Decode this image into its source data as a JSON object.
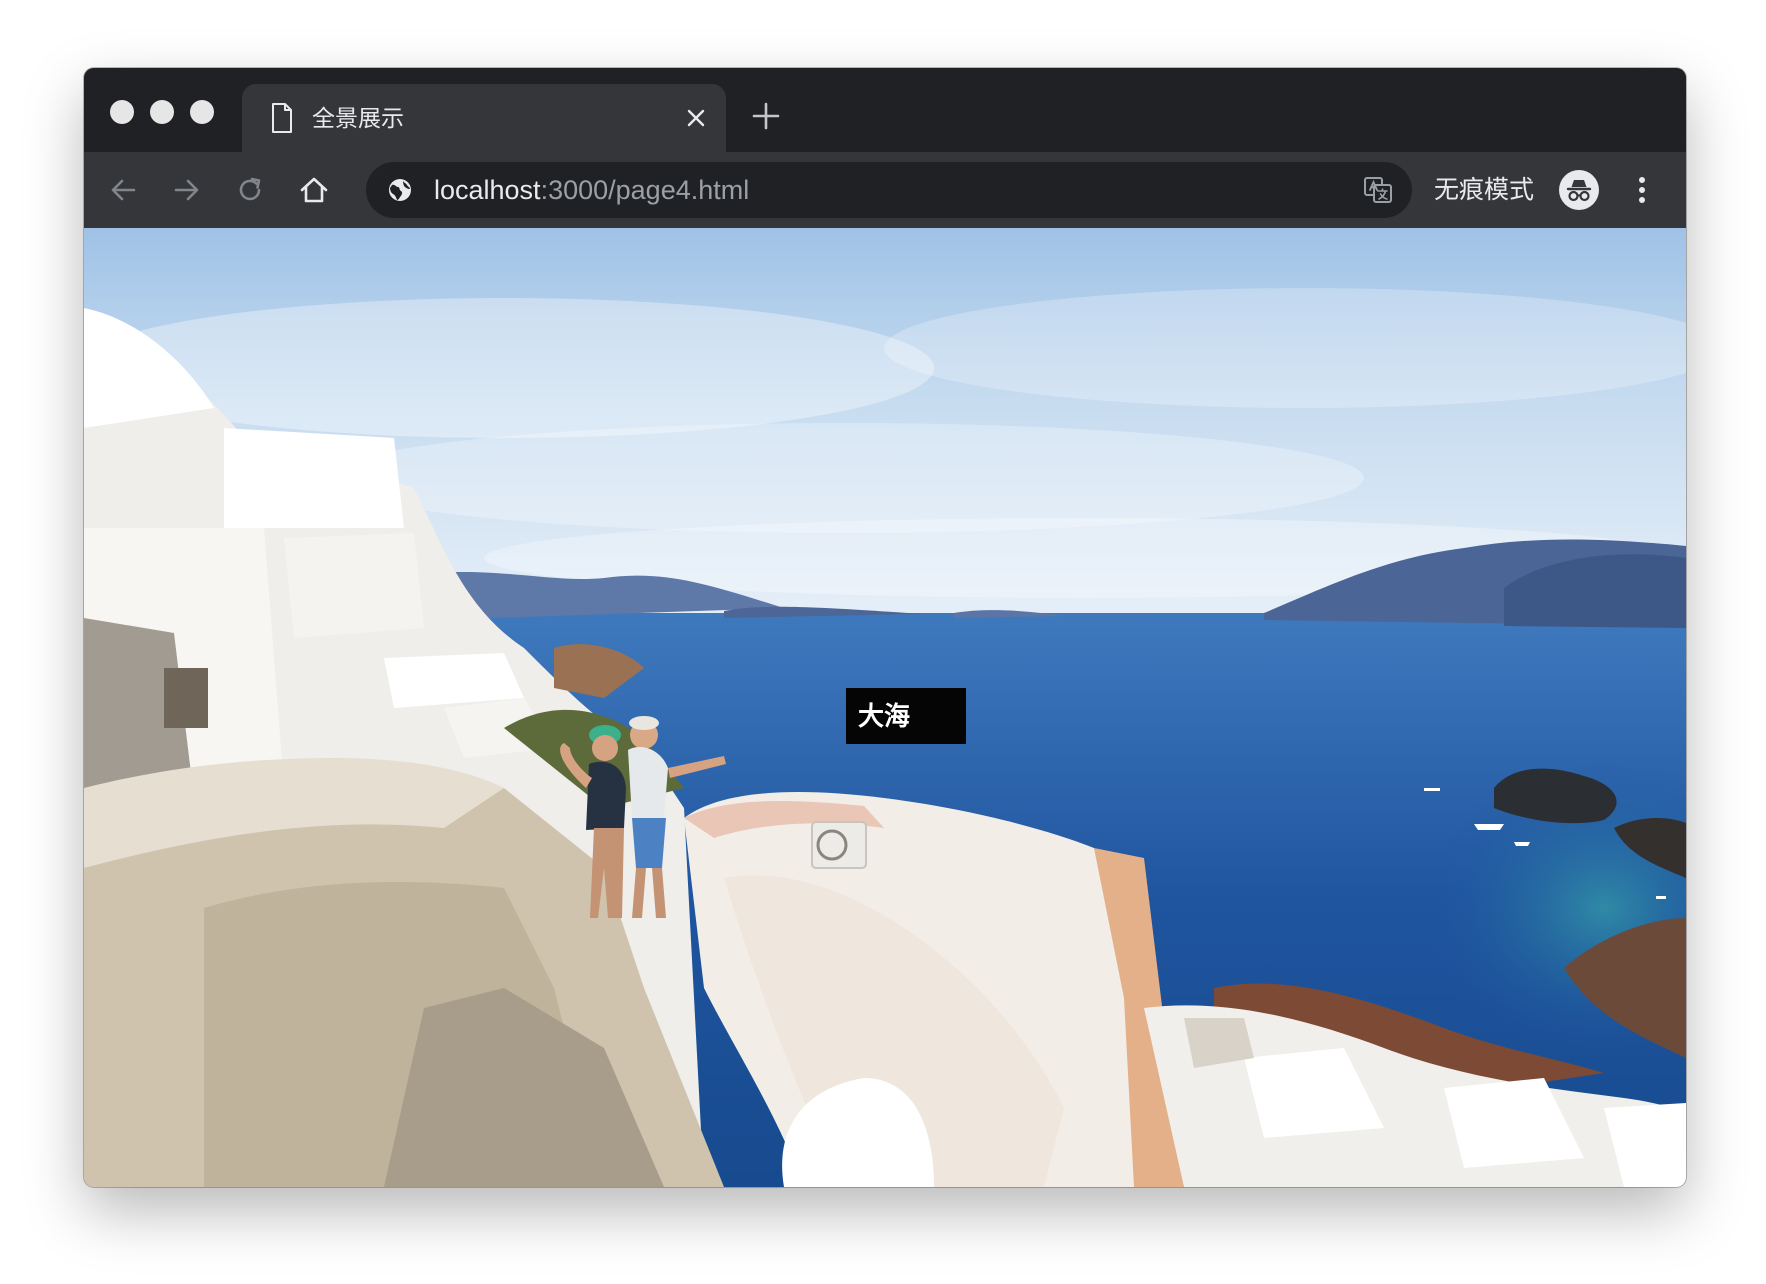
{
  "tab": {
    "title": "全景展示",
    "icon": "document-icon"
  },
  "toolbar": {
    "url_host": "localhost",
    "url_rest": ":3000/page4.html",
    "incognito_label": "无痕模式"
  },
  "content": {
    "hotspot_label": "大海"
  },
  "colors": {
    "titlebar": "#202124",
    "toolbar": "#35363a",
    "omnibox": "#202124",
    "text": "#e8eaed",
    "url_secondary": "#9aa0a6",
    "hotspot_bg": "#050505"
  }
}
